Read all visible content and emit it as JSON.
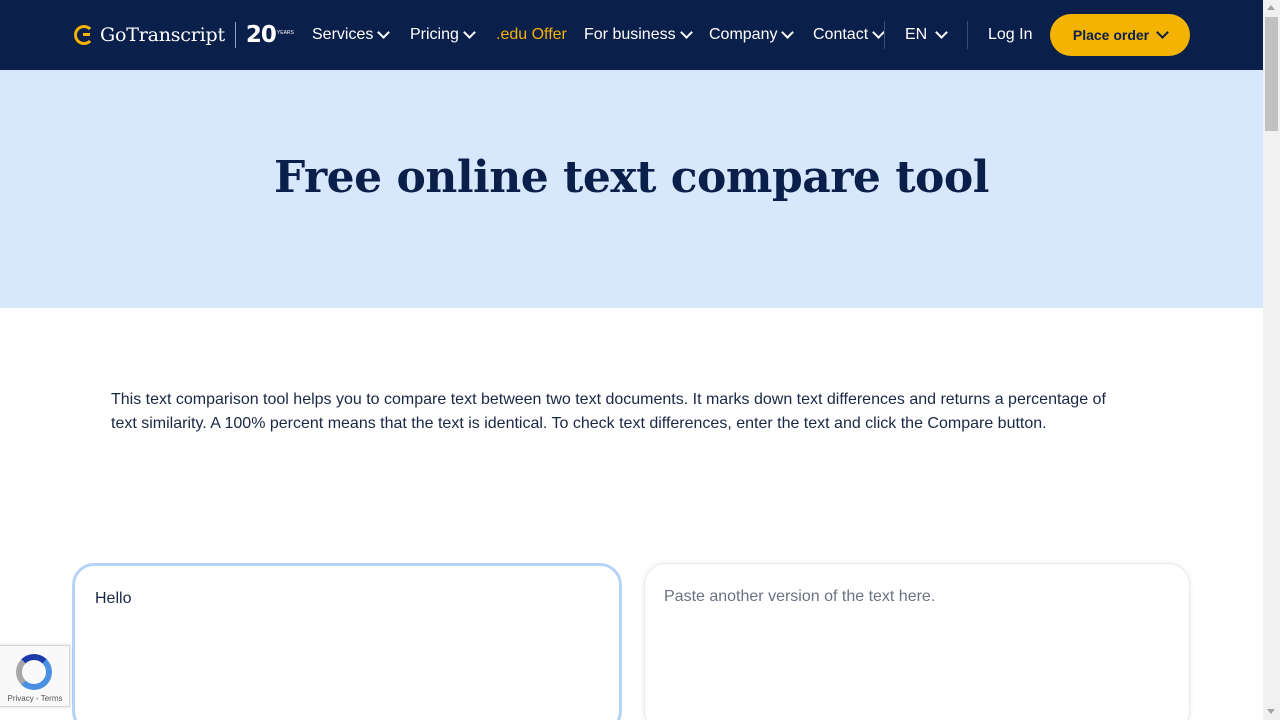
{
  "header": {
    "logo_text": "GoTranscript",
    "logo_badge": "20",
    "logo_badge_sub": "YEARS",
    "nav": {
      "services": "Services",
      "pricing": "Pricing",
      "edu_offer": ".edu Offer",
      "for_business": "For business",
      "company": "Company",
      "contact": "Contact",
      "language": "EN",
      "login": "Log In"
    },
    "order_button": "Place order"
  },
  "hero": {
    "title": "Free online text compare tool"
  },
  "intro": {
    "text": "This text comparison tool helps you to compare text between two text documents. It marks down text differences and returns a percentage of text similarity. A 100% percent means that the text is identical. To check text differences, enter the text and click the Compare button."
  },
  "compare": {
    "left_value": "Hello",
    "right_placeholder": "Paste another version of the text here."
  },
  "recaptcha": {
    "privacy": "Privacy",
    "separator": "-",
    "terms": "Terms"
  },
  "colors": {
    "navy": "#0b1f4b",
    "accent": "#f5b301",
    "hero_bg": "#d7e8fc"
  }
}
